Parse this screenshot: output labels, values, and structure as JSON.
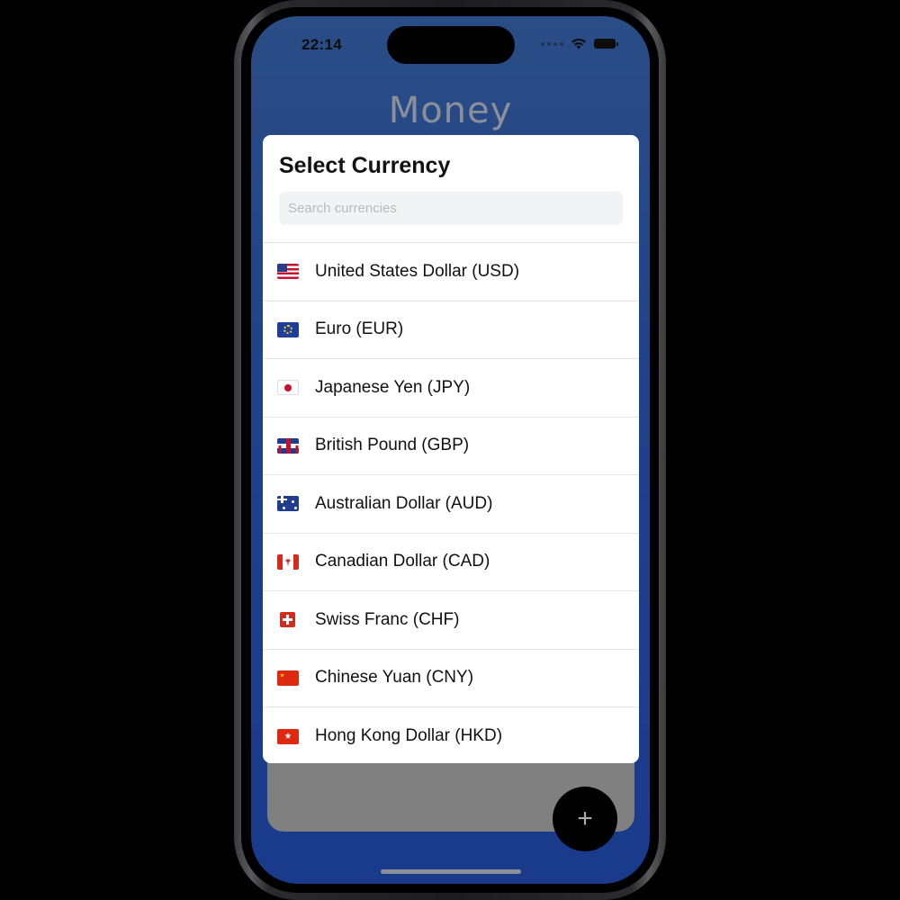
{
  "status_bar": {
    "time": "22:14"
  },
  "app": {
    "title": "Money",
    "fab_label": "+"
  },
  "modal": {
    "title": "Select Currency",
    "search": {
      "placeholder": "Search currencies",
      "value": ""
    },
    "currencies": [
      {
        "label": "United States Dollar (USD)",
        "flag_icon": "us-flag-icon"
      },
      {
        "label": "Euro (EUR)",
        "flag_icon": "eu-flag-icon"
      },
      {
        "label": "Japanese Yen (JPY)",
        "flag_icon": "jp-flag-icon"
      },
      {
        "label": "British Pound (GBP)",
        "flag_icon": "gb-flag-icon"
      },
      {
        "label": "Australian Dollar (AUD)",
        "flag_icon": "au-flag-icon"
      },
      {
        "label": "Canadian Dollar (CAD)",
        "flag_icon": "ca-flag-icon"
      },
      {
        "label": "Swiss Franc (CHF)",
        "flag_icon": "ch-flag-icon"
      },
      {
        "label": "Chinese Yuan (CNY)",
        "flag_icon": "cn-flag-icon"
      },
      {
        "label": "Hong Kong Dollar (HKD)",
        "flag_icon": "hk-flag-icon"
      }
    ]
  },
  "colors": {
    "background_top": "#2a4d86",
    "background_bottom": "#1a3a8c",
    "title_color": "#8b8f99",
    "card_gray": "#808080",
    "fab": "#000000"
  }
}
